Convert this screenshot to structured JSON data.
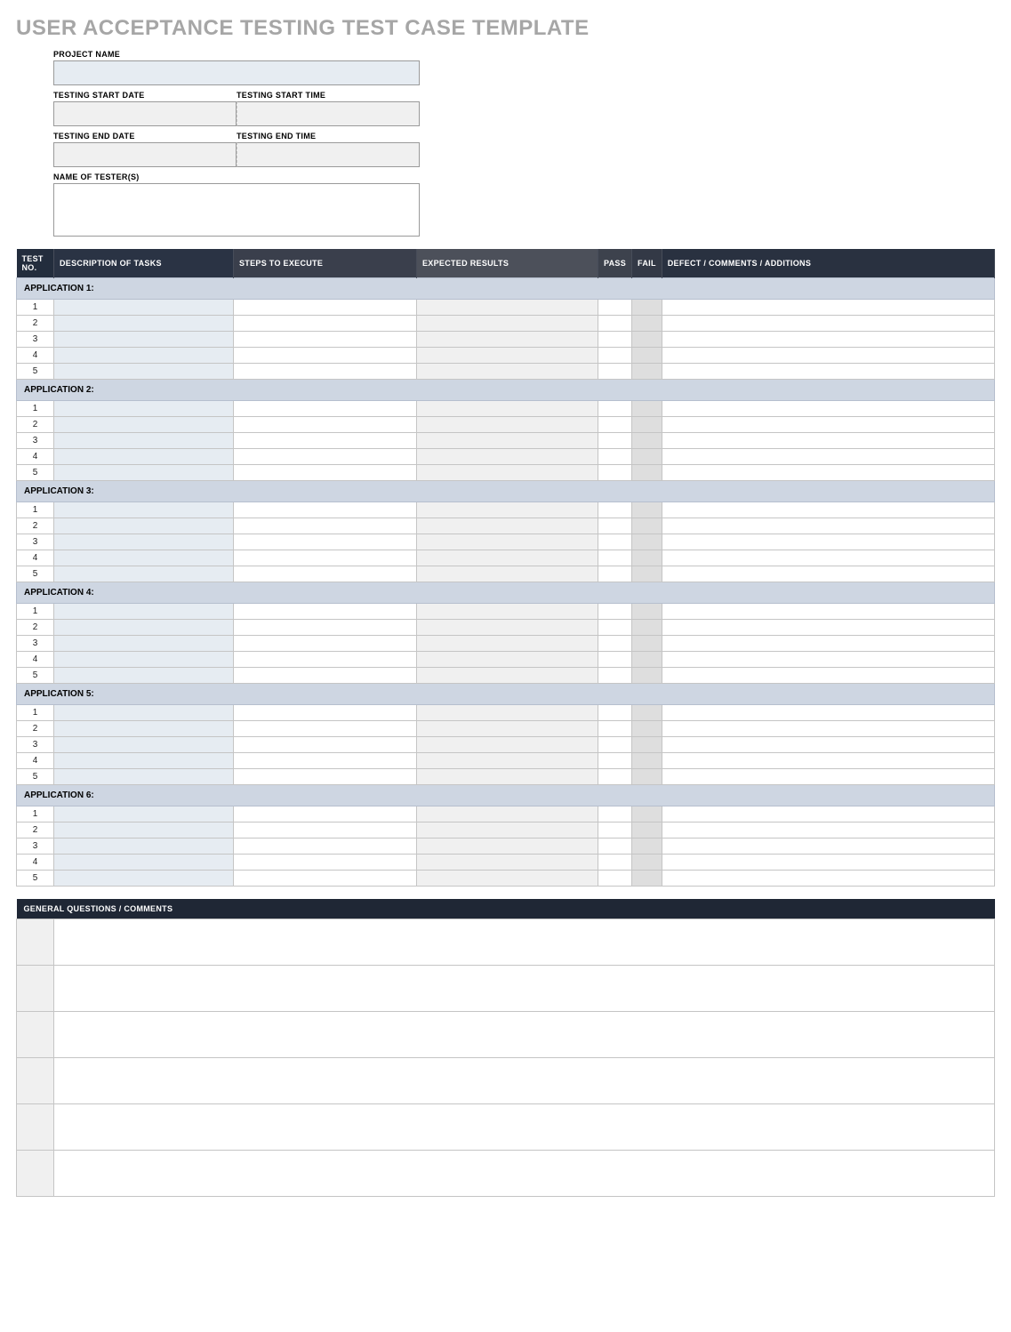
{
  "title": "USER ACCEPTANCE TESTING TEST CASE TEMPLATE",
  "header": {
    "project_name_label": "PROJECT NAME",
    "testing_start_date_label": "TESTING START DATE",
    "testing_start_time_label": "TESTING START TIME",
    "testing_end_date_label": "TESTING END DATE",
    "testing_end_time_label": "TESTING END TIME",
    "tester_label": "NAME OF TESTER(S)",
    "project_name": "",
    "testing_start_date": "",
    "testing_start_time": "",
    "testing_end_date": "",
    "testing_end_time": "",
    "tester": ""
  },
  "columns": {
    "test_no": "TEST NO.",
    "description": "DESCRIPTION OF TASKS",
    "steps": "STEPS TO EXECUTE",
    "expected": "EXPECTED RESULTS",
    "pass": "PASS",
    "fail": "FAIL",
    "defect": "DEFECT / COMMENTS / ADDITIONS"
  },
  "sections": [
    {
      "title": "APPLICATION 1:",
      "rows": [
        {
          "no": "1",
          "desc": "",
          "steps": "",
          "expected": "",
          "pass": "",
          "fail": "",
          "defect": ""
        },
        {
          "no": "2",
          "desc": "",
          "steps": "",
          "expected": "",
          "pass": "",
          "fail": "",
          "defect": ""
        },
        {
          "no": "3",
          "desc": "",
          "steps": "",
          "expected": "",
          "pass": "",
          "fail": "",
          "defect": ""
        },
        {
          "no": "4",
          "desc": "",
          "steps": "",
          "expected": "",
          "pass": "",
          "fail": "",
          "defect": ""
        },
        {
          "no": "5",
          "desc": "",
          "steps": "",
          "expected": "",
          "pass": "",
          "fail": "",
          "defect": ""
        }
      ]
    },
    {
      "title": "APPLICATION 2:",
      "rows": [
        {
          "no": "1",
          "desc": "",
          "steps": "",
          "expected": "",
          "pass": "",
          "fail": "",
          "defect": ""
        },
        {
          "no": "2",
          "desc": "",
          "steps": "",
          "expected": "",
          "pass": "",
          "fail": "",
          "defect": ""
        },
        {
          "no": "3",
          "desc": "",
          "steps": "",
          "expected": "",
          "pass": "",
          "fail": "",
          "defect": ""
        },
        {
          "no": "4",
          "desc": "",
          "steps": "",
          "expected": "",
          "pass": "",
          "fail": "",
          "defect": ""
        },
        {
          "no": "5",
          "desc": "",
          "steps": "",
          "expected": "",
          "pass": "",
          "fail": "",
          "defect": ""
        }
      ]
    },
    {
      "title": "APPLICATION 3:",
      "rows": [
        {
          "no": "1",
          "desc": "",
          "steps": "",
          "expected": "",
          "pass": "",
          "fail": "",
          "defect": ""
        },
        {
          "no": "2",
          "desc": "",
          "steps": "",
          "expected": "",
          "pass": "",
          "fail": "",
          "defect": ""
        },
        {
          "no": "3",
          "desc": "",
          "steps": "",
          "expected": "",
          "pass": "",
          "fail": "",
          "defect": ""
        },
        {
          "no": "4",
          "desc": "",
          "steps": "",
          "expected": "",
          "pass": "",
          "fail": "",
          "defect": ""
        },
        {
          "no": "5",
          "desc": "",
          "steps": "",
          "expected": "",
          "pass": "",
          "fail": "",
          "defect": ""
        }
      ]
    },
    {
      "title": "APPLICATION 4:",
      "rows": [
        {
          "no": "1",
          "desc": "",
          "steps": "",
          "expected": "",
          "pass": "",
          "fail": "",
          "defect": ""
        },
        {
          "no": "2",
          "desc": "",
          "steps": "",
          "expected": "",
          "pass": "",
          "fail": "",
          "defect": ""
        },
        {
          "no": "3",
          "desc": "",
          "steps": "",
          "expected": "",
          "pass": "",
          "fail": "",
          "defect": ""
        },
        {
          "no": "4",
          "desc": "",
          "steps": "",
          "expected": "",
          "pass": "",
          "fail": "",
          "defect": ""
        },
        {
          "no": "5",
          "desc": "",
          "steps": "",
          "expected": "",
          "pass": "",
          "fail": "",
          "defect": ""
        }
      ]
    },
    {
      "title": "APPLICATION 5:",
      "rows": [
        {
          "no": "1",
          "desc": "",
          "steps": "",
          "expected": "",
          "pass": "",
          "fail": "",
          "defect": ""
        },
        {
          "no": "2",
          "desc": "",
          "steps": "",
          "expected": "",
          "pass": "",
          "fail": "",
          "defect": ""
        },
        {
          "no": "3",
          "desc": "",
          "steps": "",
          "expected": "",
          "pass": "",
          "fail": "",
          "defect": ""
        },
        {
          "no": "4",
          "desc": "",
          "steps": "",
          "expected": "",
          "pass": "",
          "fail": "",
          "defect": ""
        },
        {
          "no": "5",
          "desc": "",
          "steps": "",
          "expected": "",
          "pass": "",
          "fail": "",
          "defect": ""
        }
      ]
    },
    {
      "title": "APPLICATION 6:",
      "rows": [
        {
          "no": "1",
          "desc": "",
          "steps": "",
          "expected": "",
          "pass": "",
          "fail": "",
          "defect": ""
        },
        {
          "no": "2",
          "desc": "",
          "steps": "",
          "expected": "",
          "pass": "",
          "fail": "",
          "defect": ""
        },
        {
          "no": "3",
          "desc": "",
          "steps": "",
          "expected": "",
          "pass": "",
          "fail": "",
          "defect": ""
        },
        {
          "no": "4",
          "desc": "",
          "steps": "",
          "expected": "",
          "pass": "",
          "fail": "",
          "defect": ""
        },
        {
          "no": "5",
          "desc": "",
          "steps": "",
          "expected": "",
          "pass": "",
          "fail": "",
          "defect": ""
        }
      ]
    }
  ],
  "general_questions": {
    "title": "GENERAL QUESTIONS / COMMENTS",
    "rows": [
      {
        "no": "",
        "text": ""
      },
      {
        "no": "",
        "text": ""
      },
      {
        "no": "",
        "text": ""
      },
      {
        "no": "",
        "text": ""
      },
      {
        "no": "",
        "text": ""
      },
      {
        "no": "",
        "text": ""
      }
    ]
  }
}
